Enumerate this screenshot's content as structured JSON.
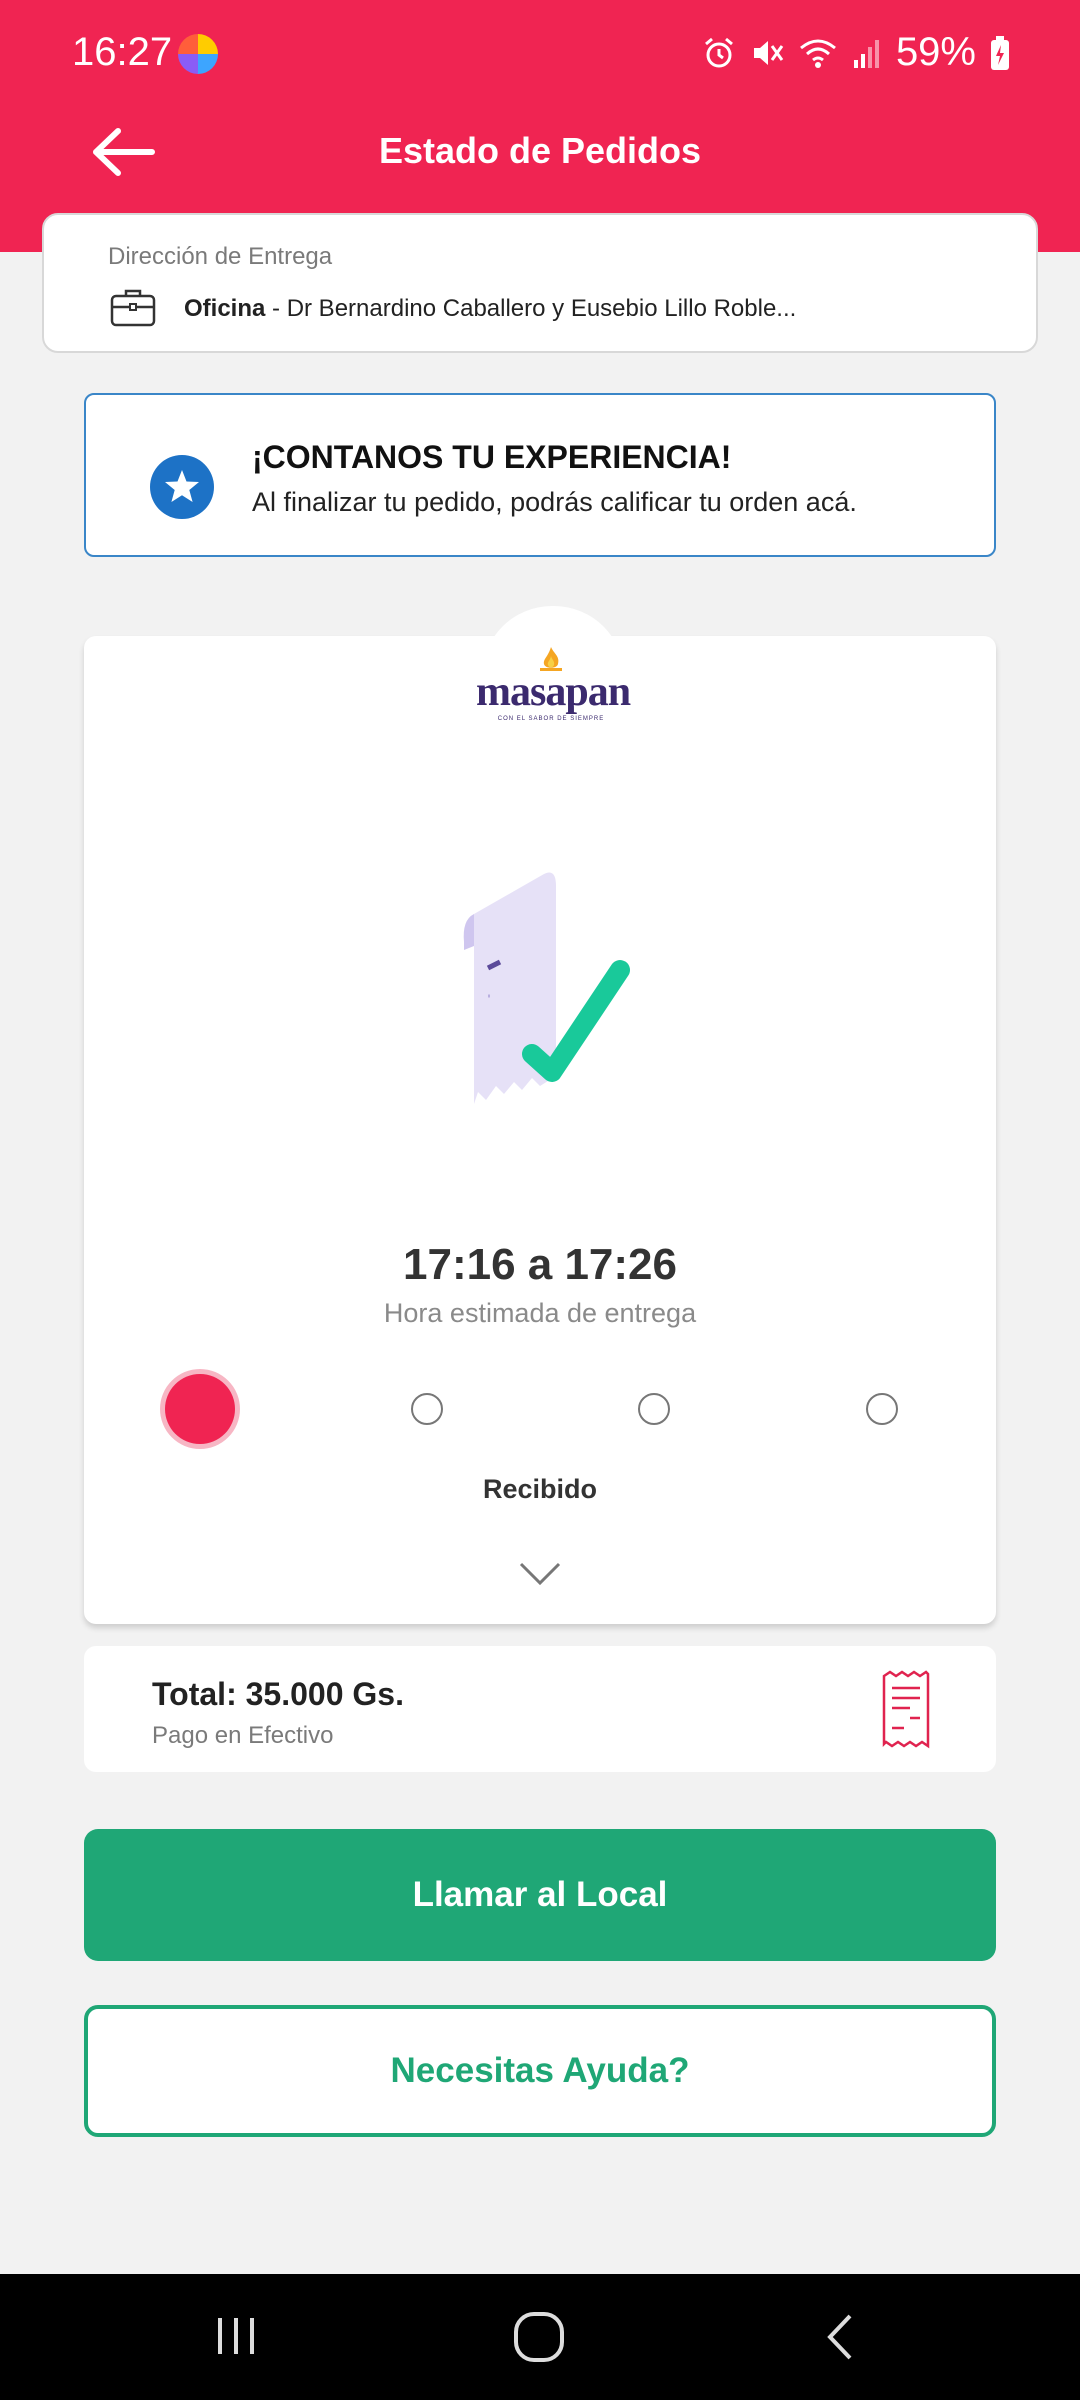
{
  "status_bar": {
    "time": "16:27",
    "battery": "59%",
    "icons": [
      "alarm-icon",
      "mute-icon",
      "wifi-icon",
      "signal-icon",
      "battery-icon"
    ]
  },
  "header": {
    "title": "Estado de Pedidos",
    "back_icon": "arrow-left-icon"
  },
  "address": {
    "label": "Dirección de Entrega",
    "name": "Oficina",
    "detail": " - Dr Bernardino Caballero y Eusebio Lillo Roble...",
    "icon": "briefcase-icon"
  },
  "experience": {
    "title": "¡CONTANOS TU EXPERIENCIA!",
    "subtitle": "Al finalizar tu pedido, podrás calificar tu orden acá.",
    "icon": "star-icon"
  },
  "order": {
    "brand": "masapan",
    "brand_tagline": "CON EL SABOR DE SIEMPRE",
    "eta": "17:16 a 17:26",
    "eta_label": "Hora estimada de entrega",
    "current_step": 1,
    "step_count": 4,
    "step_label": "Recibido"
  },
  "total": {
    "amount": "Total: 35.000 Gs.",
    "payment": "Pago en Efectivo"
  },
  "actions": {
    "call": "Llamar al Local",
    "help": "Necesitas Ayuda?"
  },
  "colors": {
    "brand_red": "#f02452",
    "green": "#1fa776",
    "blue": "#1d72c6"
  }
}
